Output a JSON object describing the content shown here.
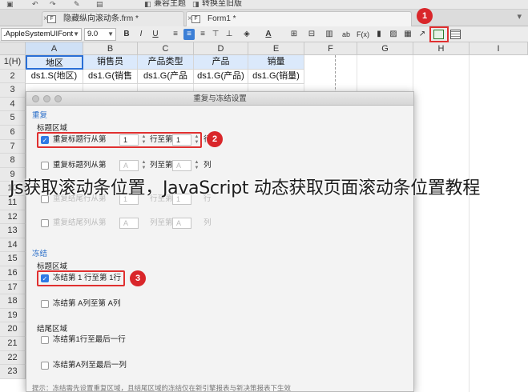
{
  "top_toolbar": {
    "compat_label": "兼容主题",
    "convert_label": "转换至旧版"
  },
  "tabs": [
    {
      "label": "隐藏纵向滚动条.frm *",
      "active": false
    },
    {
      "label": "Form1 *",
      "active": true
    }
  ],
  "format_bar": {
    "font": ".AppleSystemUIFont",
    "size": "9.0",
    "bold": "B",
    "italic": "I",
    "underline": "U",
    "abbr": "ab",
    "formula": "F(x)"
  },
  "badges": {
    "b1": "1",
    "b2": "2",
    "b3": "3"
  },
  "sheet": {
    "columns": [
      "A",
      "B",
      "C",
      "D",
      "E",
      "F",
      "G",
      "H",
      "I"
    ],
    "rows": [
      "1(H)",
      "2",
      "3",
      "4",
      "5",
      "6",
      "7",
      "8",
      "9",
      "10",
      "11",
      "12",
      "13",
      "14",
      "15",
      "16",
      "17",
      "18",
      "19",
      "20",
      "21",
      "22",
      "23"
    ],
    "row1": [
      "地区",
      "销售员",
      "产品类型",
      "产品",
      "销量"
    ],
    "row2": [
      "ds1.S(地区)",
      "ds1.G(销售",
      "ds1.G(产品",
      "ds1.G(产品)",
      "ds1.G(销量)"
    ]
  },
  "dialog": {
    "title": "重复与冻结设置",
    "repeat_section": "重复",
    "title_area": "标题区域",
    "repeat_row": {
      "pre": "重复标题行从第",
      "from": "1",
      "mid": "行至第",
      "to": "1",
      "post": "行"
    },
    "repeat_col": {
      "pre": "重复标题列从第",
      "from": "A",
      "mid": "列至第",
      "to": "A",
      "post": "列"
    },
    "tail_row": {
      "pre": "重复结尾行从第",
      "from": "1",
      "mid": "行至第",
      "to": "1",
      "post": "行"
    },
    "tail_col": {
      "pre": "重复结尾列从第",
      "from": "A",
      "mid": "列至第",
      "to": "A",
      "post": "列"
    },
    "freeze_section": "冻结",
    "freeze_title_area": "标题区域",
    "freeze_row": "冻结第 1 行至第 1行",
    "freeze_col": "冻结第 A列至第 A列",
    "tail_area": "结尾区域",
    "freeze_tail_row": "冻结第1行至最后一行",
    "freeze_tail_col": "冻结第A列至最后一列",
    "hint": "提示：冻结需先设置重复区域，且结尾区域的冻结仅在新引擎报表与新决策报表下生效"
  },
  "caption": "Js获取滚动条位置，JavaScript 动态获取页面滚动条位置教程",
  "colors": {
    "accent": "#2f7ae5",
    "highlight": "#e03030",
    "badge": "#d9262a",
    "section": "#2b6fc9"
  }
}
